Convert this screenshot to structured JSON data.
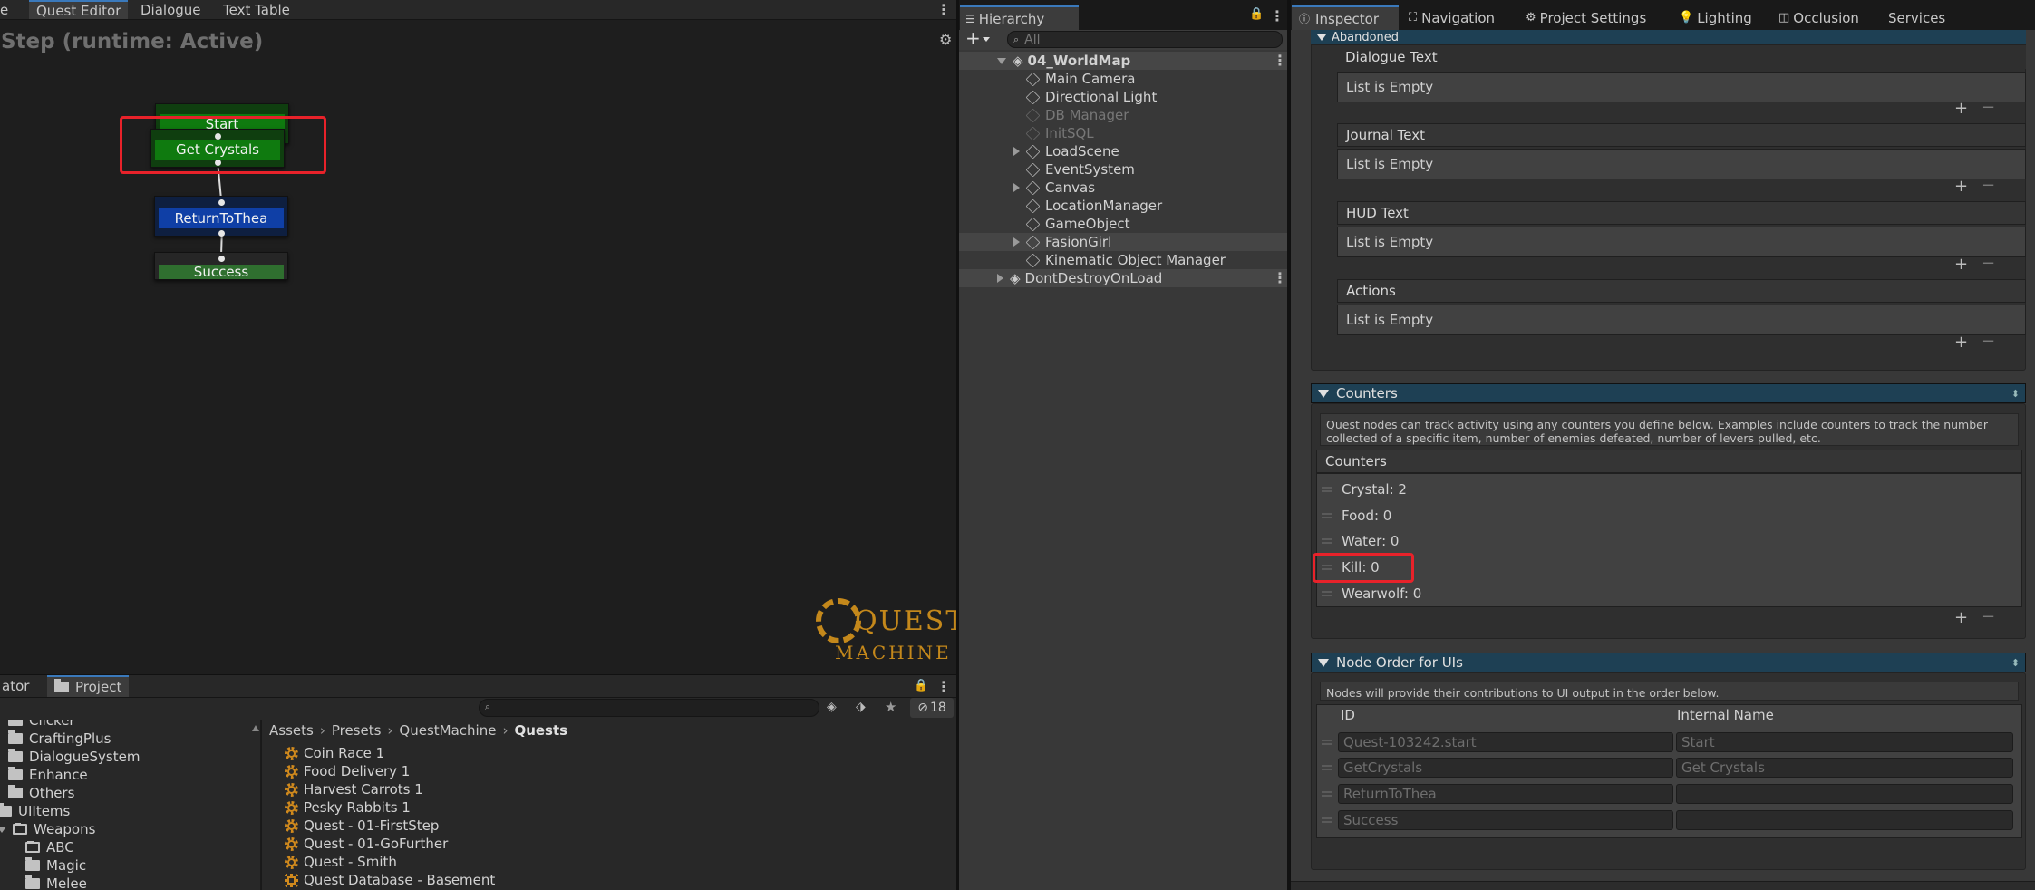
{
  "quest_editor": {
    "tabs": [
      "e",
      "Quest Editor",
      "Dialogue",
      "Text Table"
    ],
    "title": "Step (runtime: Active)",
    "nodes": [
      "Start",
      "Get Crystals",
      "ReturnToThea",
      "Success"
    ],
    "logo_line1": "QUEST",
    "logo_line2": "MACHINE"
  },
  "project": {
    "tabs": [
      "ator",
      "Project"
    ],
    "hidden_count": "18",
    "tree": [
      "Clicker",
      "CraftingPlus",
      "DialogueSystem",
      "Enhance",
      "Others",
      "UIItems",
      "Weapons",
      "ABC",
      "Magic",
      "Melee"
    ],
    "breadcrumb": [
      "Assets",
      "Presets",
      "QuestMachine",
      "Quests"
    ],
    "assets": [
      "Coin Race 1",
      "Food Delivery 1",
      "Harvest Carrots 1",
      "Pesky Rabbits 1",
      "Quest - 01-FirstStep",
      "Quest - 01-GoFurther",
      "Quest - Smith",
      "Quest Database - Basement"
    ]
  },
  "hierarchy": {
    "tab": "Hierarchy",
    "search_placeholder": "All",
    "scene": "04_WorldMap",
    "items": [
      "Main Camera",
      "Directional Light",
      "DB Manager",
      "InitSQL",
      "LoadScene",
      "EventSystem",
      "Canvas",
      "LocationManager",
      "GameObject",
      "FasionGirl",
      "Kinematic Object Manager"
    ],
    "dont_destroy": "DontDestroyOnLoad"
  },
  "inspector": {
    "tabs": [
      "Inspector",
      "Navigation",
      "Project Settings",
      "Lighting",
      "Occlusion",
      "Services"
    ],
    "abandoned": "Abandoned",
    "lists": [
      "Dialogue Text",
      "Journal Text",
      "HUD Text",
      "Actions"
    ],
    "empty_label": "List is Empty",
    "counters_header": "Counters",
    "counters_help": "Quest nodes can track activity using any counters you define below. Examples include counters to track the number collected of a specific item, number of enemies defeated, number of levers pulled, etc.",
    "counters_label": "Counters",
    "counters": [
      "Crystal: 2",
      "Food: 0",
      "Water: 0",
      "Kill: 0",
      "Wearwolf: 0"
    ],
    "node_order_header": "Node Order for UIs",
    "node_order_help": "Nodes will provide their contributions to UI output in the order below.",
    "col_id": "ID",
    "col_internal": "Internal Name",
    "rows": [
      {
        "id": "Quest-103242.start",
        "name": "Start"
      },
      {
        "id": "GetCrystals",
        "name": "Get Crystals"
      },
      {
        "id": "ReturnToThea",
        "name": ""
      },
      {
        "id": "Success",
        "name": ""
      }
    ]
  }
}
